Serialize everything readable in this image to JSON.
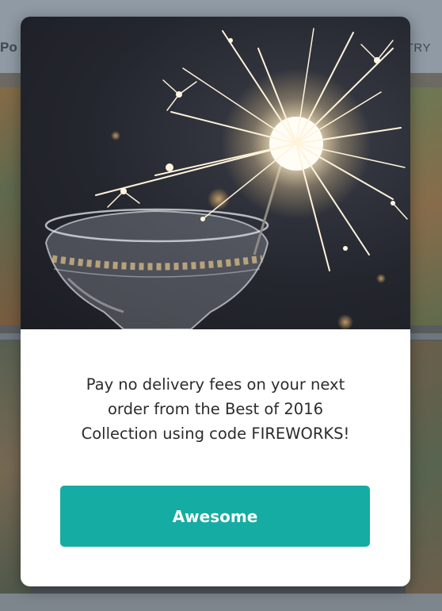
{
  "background": {
    "tab_left_label": "Po",
    "tab_right_label": "TRY"
  },
  "modal": {
    "image_description_name": "sparkler-champagne-glass",
    "message": "Pay no delivery fees on your next order from the Best of 2016 Collection using code FIREWORKS!",
    "message_lines": [
      "Pay no delivery fees on your next",
      "order from the Best of 2016",
      "Collection using code FIREWORKS!"
    ],
    "button_label": "Awesome"
  },
  "colors": {
    "accent": "#15aca3",
    "modal_background": "#ffffff",
    "overlay": "#5b6470",
    "text": "#2b2b2b"
  }
}
